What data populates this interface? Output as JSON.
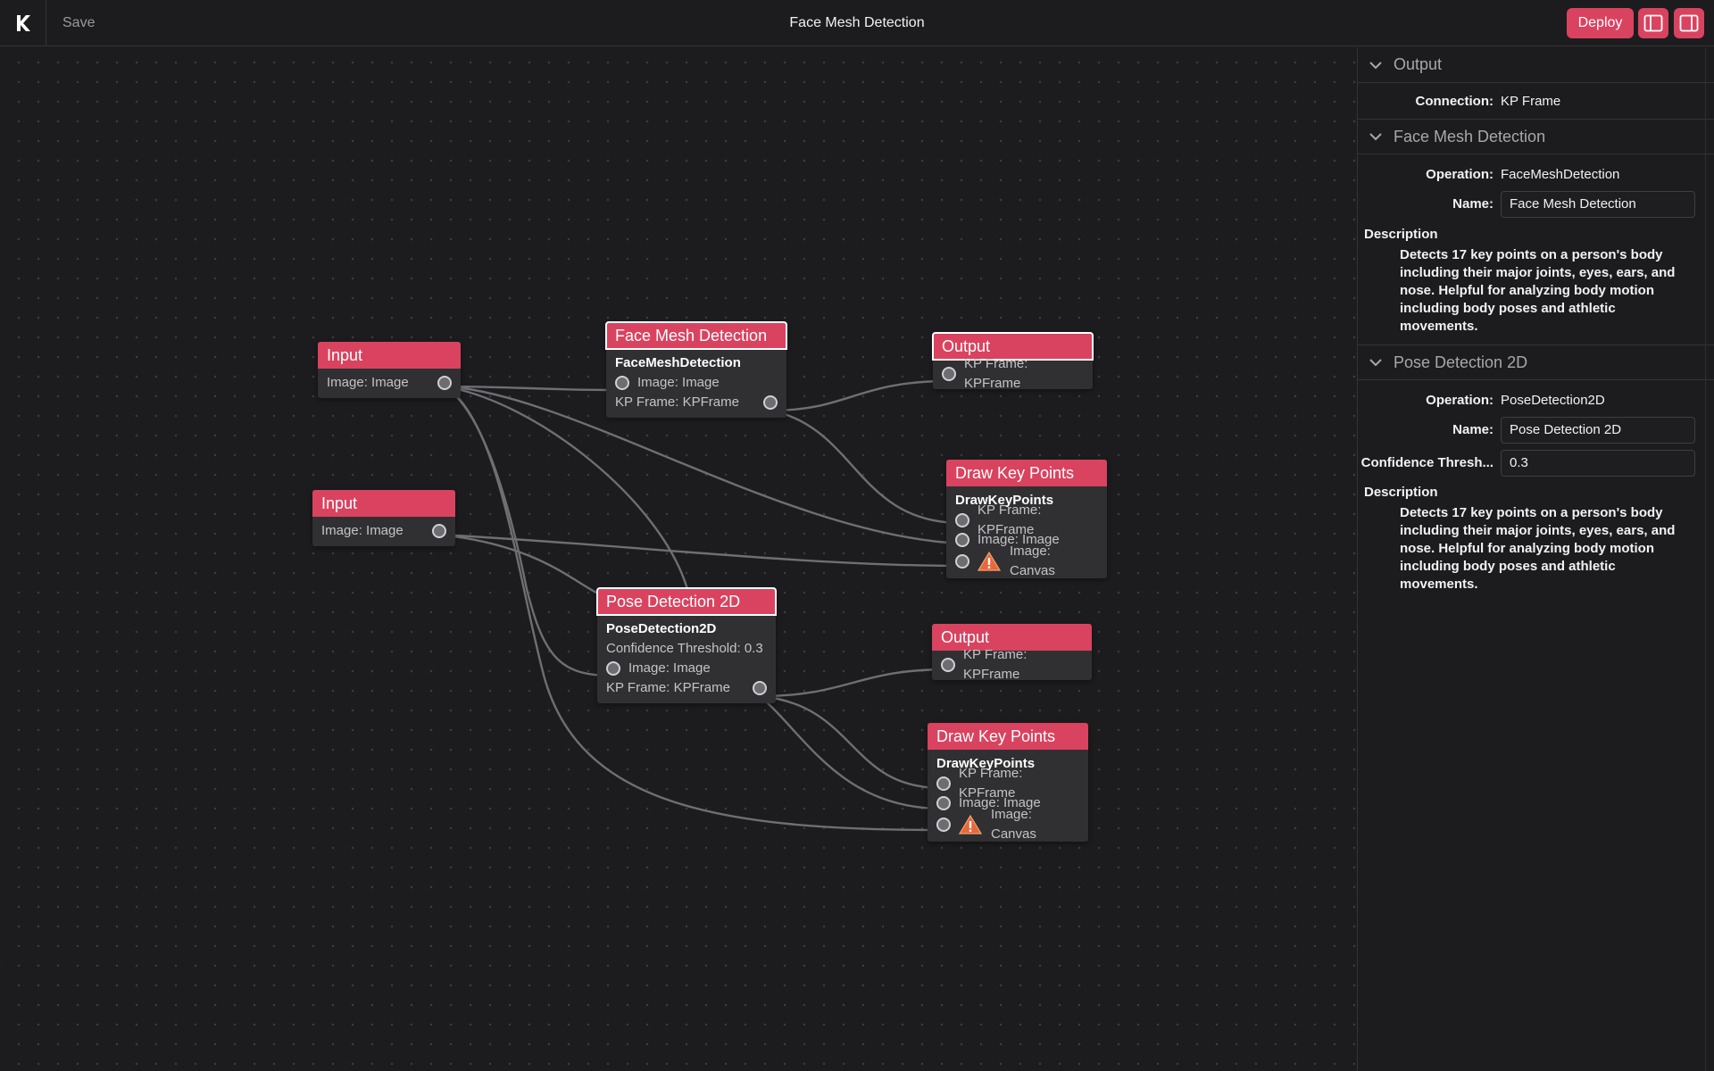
{
  "app": {
    "title": "Face Mesh Detection",
    "save_label": "Save",
    "deploy_label": "Deploy",
    "accent_color": "#d9435f"
  },
  "icons": {
    "logo": "k-logo-icon",
    "toggle_left_panel": "sidebar-left-icon",
    "toggle_right_panel": "sidebar-right-icon",
    "collapse": "chevron-down-icon",
    "warning": "warning-triangle-icon"
  },
  "nodes": {
    "input1": {
      "title": "Input",
      "outputs": [
        "Image: Image"
      ]
    },
    "input2": {
      "title": "Input",
      "outputs": [
        "Image: Image"
      ]
    },
    "facemesh": {
      "title": "Face Mesh Detection",
      "operation": "FaceMeshDetection",
      "inputs": [
        "Image: Image"
      ],
      "outputs": [
        "KP Frame: KPFrame"
      ]
    },
    "output1": {
      "title": "Output",
      "inputs": [
        "KP Frame: KPFrame"
      ]
    },
    "draw1": {
      "title": "Draw Key Points",
      "operation": "DrawKeyPoints",
      "inputs": [
        "KP Frame: KPFrame",
        "Image: Image",
        "Image: Canvas"
      ]
    },
    "pose": {
      "title": "Pose Detection 2D",
      "operation": "PoseDetection2D",
      "params": [
        "Confidence Threshold: 0.3"
      ],
      "inputs": [
        "Image: Image"
      ],
      "outputs": [
        "KP Frame: KPFrame"
      ]
    },
    "output2": {
      "title": "Output",
      "inputs": [
        "KP Frame: KPFrame"
      ]
    },
    "draw2": {
      "title": "Draw Key Points",
      "operation": "DrawKeyPoints",
      "inputs": [
        "KP Frame: KPFrame",
        "Image: Image",
        "Image: Canvas"
      ]
    }
  },
  "inspector": {
    "output": {
      "heading": "Output",
      "connection_label": "Connection:",
      "connection_value": "KP Frame"
    },
    "facemesh": {
      "heading": "Face Mesh Detection",
      "operation_label": "Operation:",
      "operation_value": "FaceMeshDetection",
      "name_label": "Name:",
      "name_value": "Face Mesh Detection",
      "description_label": "Description",
      "description": "Detects 17 key points on a person's body including their major joints, eyes, ears, and nose. Helpful for analyzing body motion including body poses and athletic movements."
    },
    "pose": {
      "heading": "Pose Detection 2D",
      "operation_label": "Operation:",
      "operation_value": "PoseDetection2D",
      "name_label": "Name:",
      "name_value": "Pose Detection 2D",
      "threshold_label": "Confidence Thresh...",
      "threshold_value": "0.3",
      "description_label": "Description",
      "description": "Detects 17 key points on a person's body including their major joints, eyes, ears, and nose. Helpful for analyzing body motion including body poses and athletic movements."
    }
  }
}
